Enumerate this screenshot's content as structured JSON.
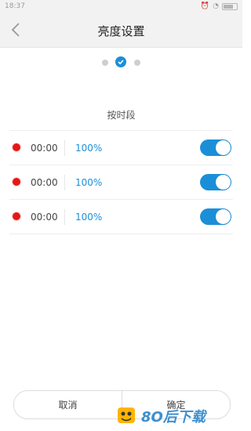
{
  "statusbar": {
    "time": "18:37"
  },
  "header": {
    "title": "亮度设置"
  },
  "section_label": "按时段",
  "rows": [
    {
      "time": "00:00",
      "brightness": "100%",
      "enabled": true
    },
    {
      "time": "00:00",
      "brightness": "100%",
      "enabled": true
    },
    {
      "time": "00:00",
      "brightness": "100%",
      "enabled": true
    }
  ],
  "footer": {
    "cancel": "取消",
    "confirm": "确定"
  },
  "colors": {
    "accent": "#1a8fd8",
    "dot": "#e61717"
  }
}
